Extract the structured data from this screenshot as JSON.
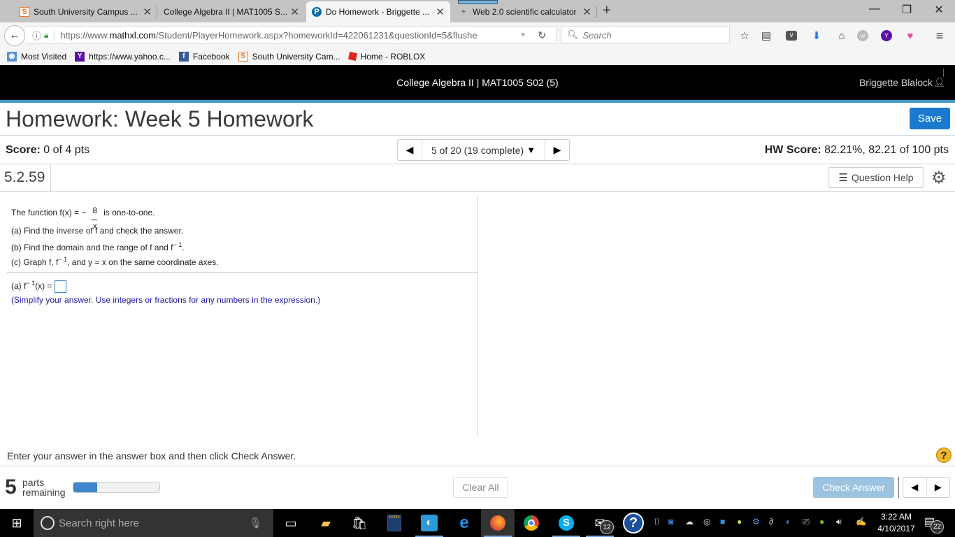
{
  "browser": {
    "tabs": [
      {
        "label": "South University Campus ...",
        "icon": "south-university-icon",
        "active": false
      },
      {
        "label": "College Algebra II | MAT1005 S...",
        "icon": "none",
        "active": false
      },
      {
        "label": "Do Homework - Briggette ...",
        "icon": "pearson-icon",
        "active": true
      },
      {
        "label": "Web 2.0 scientific calculator",
        "icon": "calculator-icon",
        "active": false
      }
    ],
    "new_tab_glyph": "+",
    "window_controls": {
      "minimize": "—",
      "restore": "❐",
      "close": "✕"
    },
    "url": {
      "prefix": "https://www.",
      "host": "mathxl.com",
      "path": "/Student/PlayerHomework.aspx?homeworkId=422061231&questionId=5&flushe"
    },
    "search_placeholder": "Search",
    "bookmarks": [
      {
        "label": "Most Visited",
        "icon": "most-visited-icon"
      },
      {
        "label": "https://www.yahoo.c...",
        "icon": "yahoo-icon"
      },
      {
        "label": "Facebook",
        "icon": "facebook-icon"
      },
      {
        "label": "South University Cam...",
        "icon": "south-university-icon"
      },
      {
        "label": "Home - ROBLOX",
        "icon": "roblox-icon"
      }
    ]
  },
  "header": {
    "course": "College Algebra II | MAT1005 S02 (5)",
    "user": "Briggette Blalock"
  },
  "homework": {
    "title": "Homework: Week 5 Homework",
    "save_label": "Save",
    "score_label": "Score:",
    "score_value": " 0 of 4 pts",
    "question_nav": "5 of 20 (19 complete)",
    "hw_score_label": "HW Score:",
    "hw_score_value": " 82.21%, 82.21 of 100 pts",
    "question_number": "5.2.59",
    "question_help_label": "Question Help"
  },
  "question": {
    "intro_pre": "The function f(x) = −",
    "frac_num": "8",
    "frac_den": "x",
    "intro_post": "is one-to-one.",
    "part_a": "(a) Find the inverse of f and check the answer.",
    "part_b_pre": "(b) Find the domain and the range of f and f",
    "part_b_sup": "− 1",
    "part_b_post": ".",
    "part_c_pre": "(c) Graph f, f",
    "part_c_sup": "− 1",
    "part_c_post": ", and y = x on the same coordinate axes.",
    "answer_pre": "(a) f",
    "answer_sup": "− 1",
    "answer_post": "(x) =",
    "answer_value": "",
    "hint": "(Simplify your answer. Use integers or fractions for any numbers in the expression.)"
  },
  "footer": {
    "instruction": "Enter your answer in the answer box and then click Check Answer.",
    "parts_remaining_count": "5",
    "parts_label_1": "parts",
    "parts_label_2": "remaining",
    "progress_fraction": 0.28,
    "clear_all_label": "Clear All",
    "check_answer_label": "Check Answer"
  },
  "taskbar": {
    "search_placeholder": "Search right here",
    "mail_badge": "12",
    "notification_badge": "22",
    "time": "3:22 AM",
    "date": "4/10/2017"
  },
  "colors": {
    "accent": "#3d9ac2",
    "save": "#1a7ad0",
    "check_answer_disabled": "#9cc3e0",
    "hint_text": "#1a1aa8",
    "progress_fill": "#3d86cd"
  }
}
